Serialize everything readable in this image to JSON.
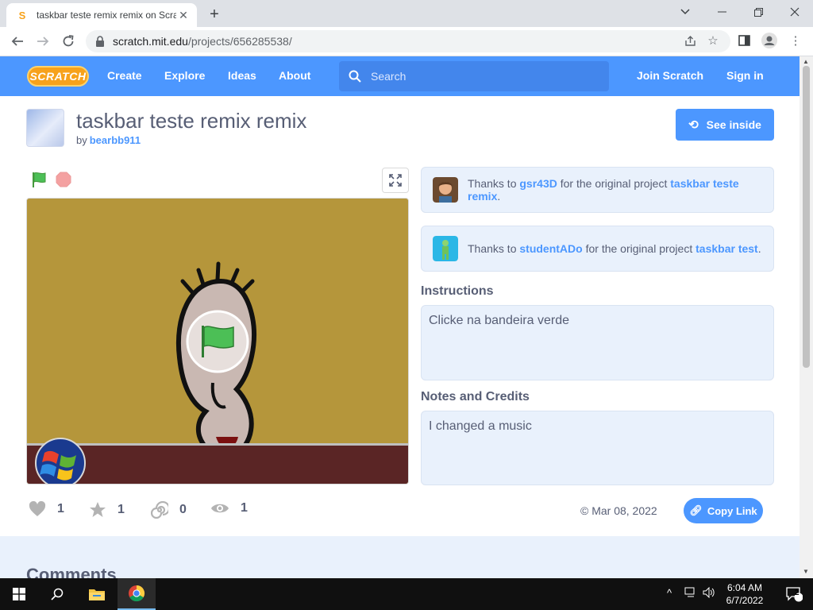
{
  "browser": {
    "tab_title": "taskbar teste remix remix on Scratch",
    "tab_favicon": "S",
    "url_domain": "scratch.mit.edu",
    "url_path": "/projects/656285538/"
  },
  "scratch_nav": {
    "logo": "SCRATCH",
    "links": [
      "Create",
      "Explore",
      "Ideas",
      "About"
    ],
    "search_placeholder": "Search",
    "join": "Join Scratch",
    "sign_in": "Sign in",
    "nav_color": "#4c97ff"
  },
  "project": {
    "title": "taskbar teste remix remix",
    "by_prefix": "by",
    "author": "bearbb911",
    "see_inside": "See inside"
  },
  "credits": [
    {
      "prefix": "Thanks to",
      "user": "gsr43D",
      "middle": "for the original project",
      "project": "taskbar teste remix",
      "suffix": "."
    },
    {
      "prefix": "Thanks to",
      "user": "studentADo",
      "middle": "for the original project",
      "project": "taskbar test",
      "suffix": "."
    }
  ],
  "instructions": {
    "heading": "Instructions",
    "text": "Clicke na bandeira verde"
  },
  "notes": {
    "heading": "Notes and Credits",
    "text": "I changed a music"
  },
  "stats": {
    "loves": "1",
    "favorites": "1",
    "remixes": "0",
    "views": "1"
  },
  "shared_date": "© Mar 08, 2022",
  "copy_link": "Copy Link",
  "comments_heading": "Comments",
  "taskbar": {
    "time": "6:04 AM",
    "date": "6/7/2022",
    "notifications": "2"
  }
}
